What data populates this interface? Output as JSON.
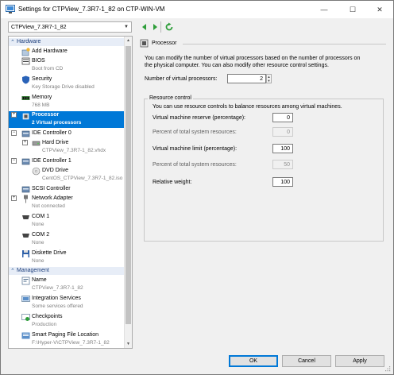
{
  "window": {
    "title": "Settings for CTPView_7.3R7-1_82 on CTP-WIN-VM",
    "minimize_glyph": "—",
    "maximize_glyph": "☐",
    "close_glyph": "✕"
  },
  "toolbar": {
    "vm_selected": "CTPView_7.3R7-1_82",
    "back_icon": "green-back-arrow",
    "forward_icon": "green-forward-arrow",
    "refresh_icon": "green-refresh"
  },
  "tree": {
    "hardware_header": "Hardware",
    "management_header": "Management",
    "items": [
      {
        "label": "Add Hardware",
        "sub": "",
        "icon": "add-hardware-icon"
      },
      {
        "label": "BIOS",
        "sub": "Boot from CD",
        "icon": "bios-icon"
      },
      {
        "label": "Security",
        "sub": "Key Storage Drive disabled",
        "icon": "shield-icon"
      },
      {
        "label": "Memory",
        "sub": "768 MB",
        "icon": "memory-icon"
      },
      {
        "label": "Processor",
        "sub": "2 Virtual processors",
        "icon": "processor-icon"
      },
      {
        "label": "IDE Controller 0",
        "sub": "",
        "icon": "ide-controller-icon"
      },
      {
        "label": "Hard Drive",
        "sub": "CTPView_7.3R7-1_82.vhdx",
        "icon": "hard-drive-icon"
      },
      {
        "label": "IDE Controller 1",
        "sub": "",
        "icon": "ide-controller-icon"
      },
      {
        "label": "DVD Drive",
        "sub": "CentOS_CTPView_7.3R7-1_82.iso",
        "icon": "dvd-drive-icon"
      },
      {
        "label": "SCSI Controller",
        "sub": "",
        "icon": "scsi-controller-icon"
      },
      {
        "label": "Network Adapter",
        "sub": "Not connected",
        "icon": "network-adapter-icon"
      },
      {
        "label": "COM 1",
        "sub": "None",
        "icon": "com-port-icon"
      },
      {
        "label": "COM 2",
        "sub": "None",
        "icon": "com-port-icon"
      },
      {
        "label": "Diskette Drive",
        "sub": "None",
        "icon": "diskette-icon"
      },
      {
        "label": "Name",
        "sub": "CTPView_7.3R7-1_82",
        "icon": "name-icon"
      },
      {
        "label": "Integration Services",
        "sub": "Some services offered",
        "icon": "integration-services-icon"
      },
      {
        "label": "Checkpoints",
        "sub": "Production",
        "icon": "checkpoints-icon"
      },
      {
        "label": "Smart Paging File Location",
        "sub": "F:\\Hyper-V\\CTPView_7.3R7-1_82",
        "icon": "smart-paging-icon"
      }
    ]
  },
  "processor": {
    "group_title": "Processor",
    "description_line1": "You can modify the number of virtual processors based on the number of processors on",
    "description_line2": "the physical computer. You can also modify other resource control settings.",
    "vp_label": "Number of virtual processors:",
    "vp_value": "2",
    "resource_control": {
      "legend": "Resource control",
      "description": "You can use resource controls to balance resources among virtual machines.",
      "reserve_label": "Virtual machine reserve (percentage):",
      "reserve_value": "0",
      "reserve_total_label": "Percent of total system resources:",
      "reserve_total_value": "0",
      "limit_label": "Virtual machine limit (percentage):",
      "limit_value": "100",
      "limit_total_label": "Percent of total system resources:",
      "limit_total_value": "50",
      "weight_label": "Relative weight:",
      "weight_value": "100"
    }
  },
  "buttons": {
    "ok": "OK",
    "cancel": "Cancel",
    "apply": "Apply"
  },
  "colors": {
    "selection": "#0078d7",
    "section_header_bg": "#e7edf7"
  }
}
